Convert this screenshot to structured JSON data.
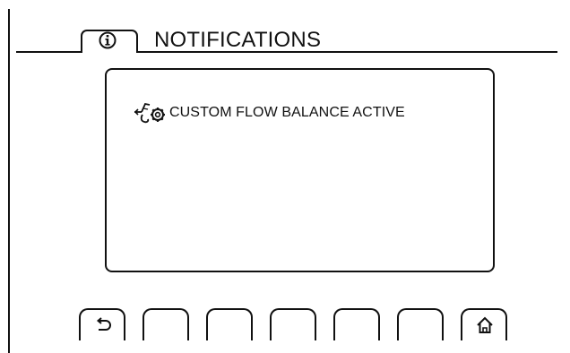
{
  "header": {
    "title": "NOTIFICATIONS",
    "tab_icon": "info-icon"
  },
  "notifications": [
    {
      "icon": "custom-flow-balance-icon",
      "text": "CUSTOM FLOW BALANCE ACTIVE"
    }
  ],
  "softkeys": [
    {
      "icon": "back-icon"
    },
    {
      "icon": ""
    },
    {
      "icon": ""
    },
    {
      "icon": ""
    },
    {
      "icon": ""
    },
    {
      "icon": ""
    },
    {
      "icon": "home-icon"
    }
  ]
}
